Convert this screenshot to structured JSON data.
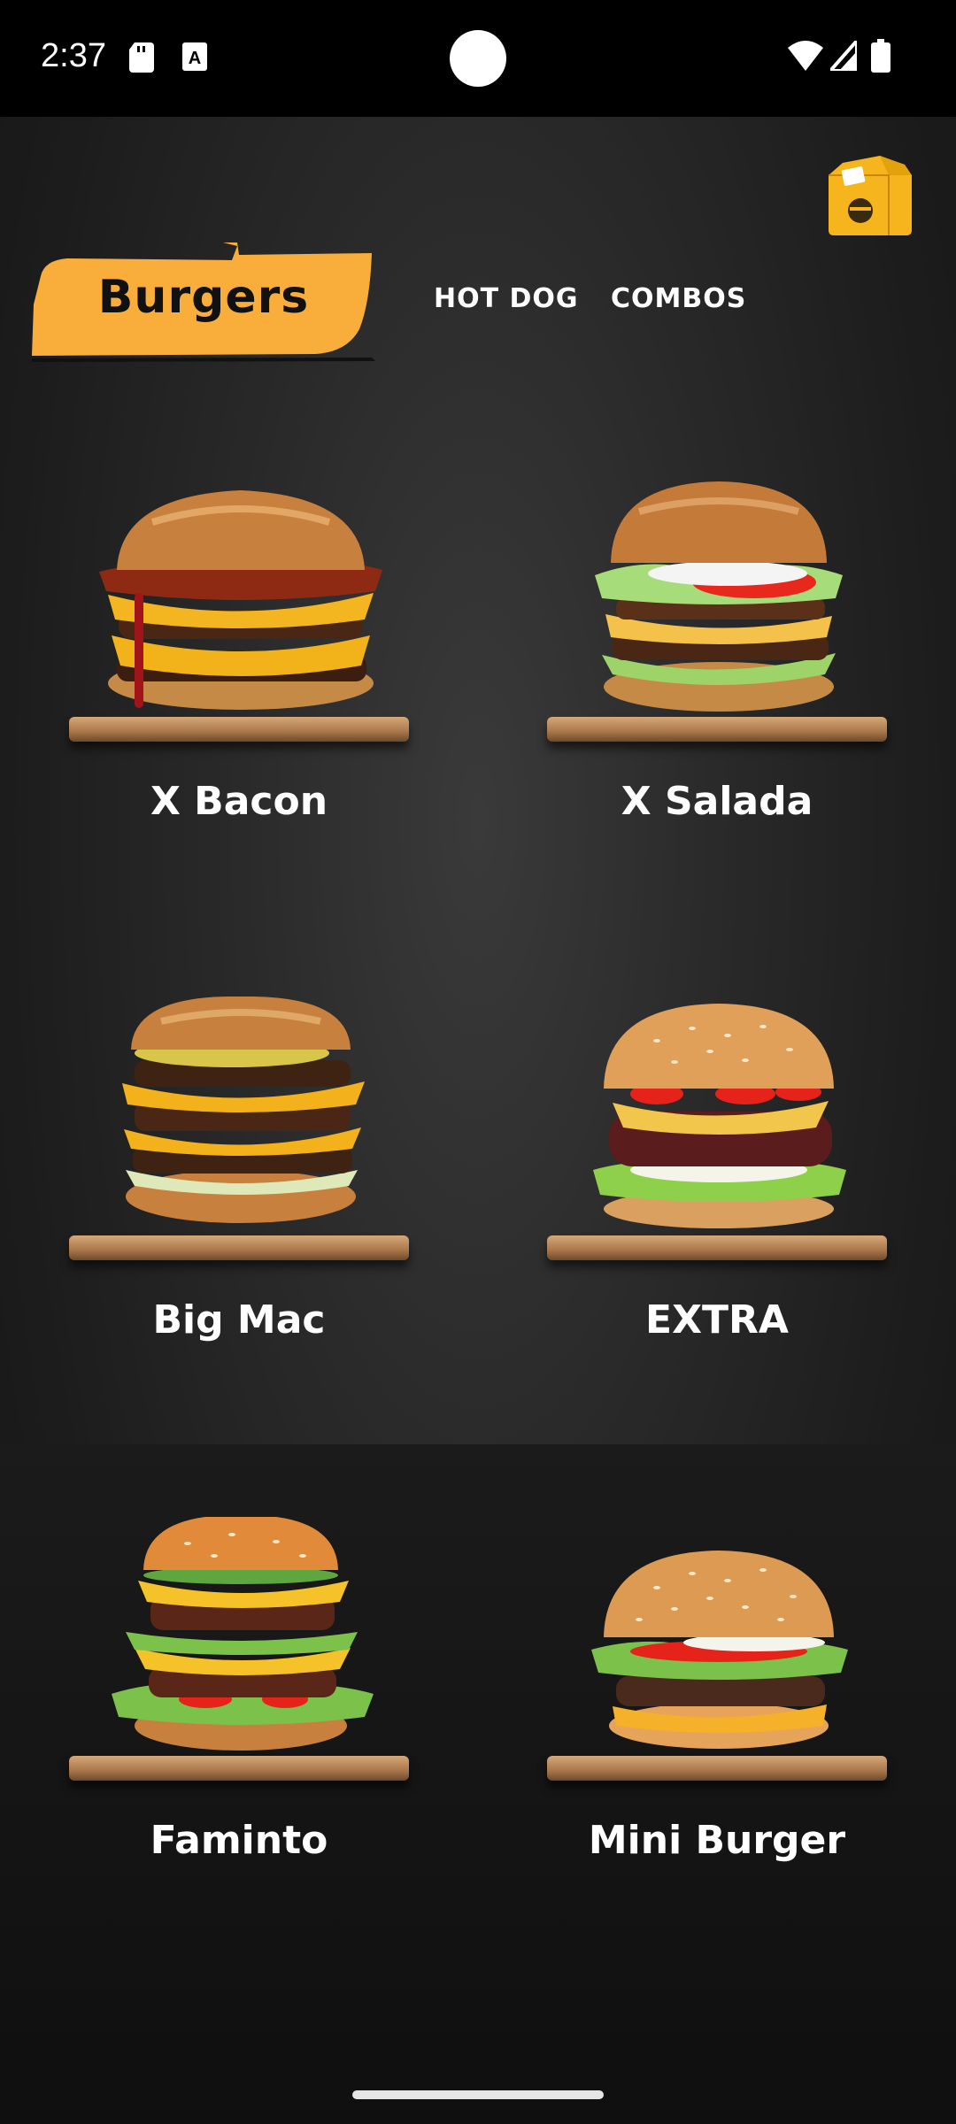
{
  "status_bar": {
    "time": "2:37"
  },
  "header": {
    "bag_icon": "shopping-bag-icon"
  },
  "tabs": [
    {
      "label": "Burgers",
      "active": true
    },
    {
      "label": "HOT DOG",
      "active": false
    },
    {
      "label": "COMBOS",
      "active": false
    }
  ],
  "products": [
    {
      "name": "X Bacon"
    },
    {
      "name": "X Salada"
    },
    {
      "name": "Big Mac"
    },
    {
      "name": "EXTRA"
    },
    {
      "name": "Faminto"
    },
    {
      "name": "Mini Burger"
    }
  ],
  "colors": {
    "accent": "#F9AE3C",
    "background": "#2A2A2A",
    "text": "#FFFFFF"
  }
}
